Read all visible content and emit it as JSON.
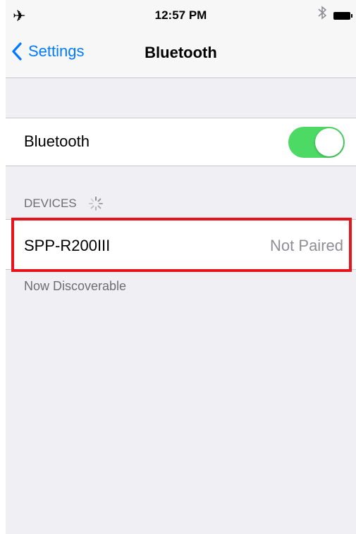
{
  "status_bar": {
    "time": "12:57 PM",
    "airplane_icon": "airplane-icon",
    "bluetooth_icon": "bluetooth-icon",
    "battery_icon": "battery-icon"
  },
  "nav": {
    "back_label": "Settings",
    "title": "Bluetooth",
    "back_icon": "chevron-left-icon"
  },
  "bluetooth_cell": {
    "label": "Bluetooth",
    "toggle_on": true,
    "toggle_color": "#4cd964"
  },
  "devices": {
    "header": "DEVICES",
    "spinner_icon": "loading-spinner-icon",
    "items": [
      {
        "name": "SPP-R200III",
        "status": "Not Paired"
      }
    ],
    "footer": "Now Discoverable"
  },
  "colors": {
    "accent": "#007aff",
    "highlight": "#e8141b"
  }
}
